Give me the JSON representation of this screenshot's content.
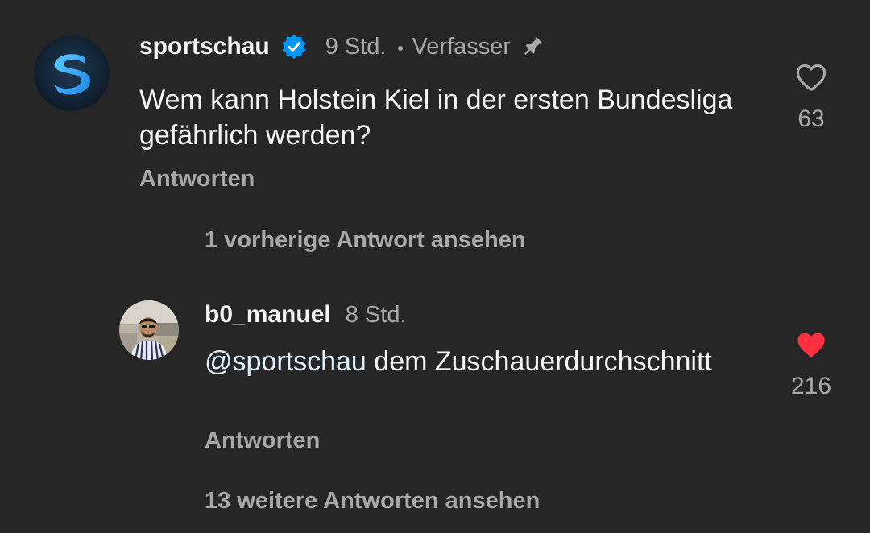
{
  "comment": {
    "username": "sportschau",
    "time": "9 Std.",
    "author_label": "Verfasser",
    "text": "Wem kann Holstein Kiel in der ersten Bundesliga gefährlich werden?",
    "reply_label": "Antworten",
    "likes": "63",
    "liked": false,
    "icons": {
      "avatar": "sportschau-logo",
      "verified": "verified-badge-icon",
      "pin": "pin-icon",
      "like": "heart-outline-icon"
    }
  },
  "view_previous": "1 vorherige Antwort ansehen",
  "reply": {
    "username": "b0_manuel",
    "time": "8 Std.",
    "mention": "@sportschau",
    "text": "dem Zuschauerdurchschnitt",
    "reply_label": "Antworten",
    "likes": "216",
    "liked": true,
    "icons": {
      "avatar": "user-photo-avatar",
      "like": "heart-filled-icon"
    }
  },
  "view_more": "13 weitere Antworten ansehen",
  "colors": {
    "background": "#262626",
    "primary_text": "#f5f5f5",
    "secondary_text": "#a8a8a8",
    "verified_blue": "#0095f6",
    "liked_red": "#ff3040",
    "mention": "#e0f1ff"
  }
}
